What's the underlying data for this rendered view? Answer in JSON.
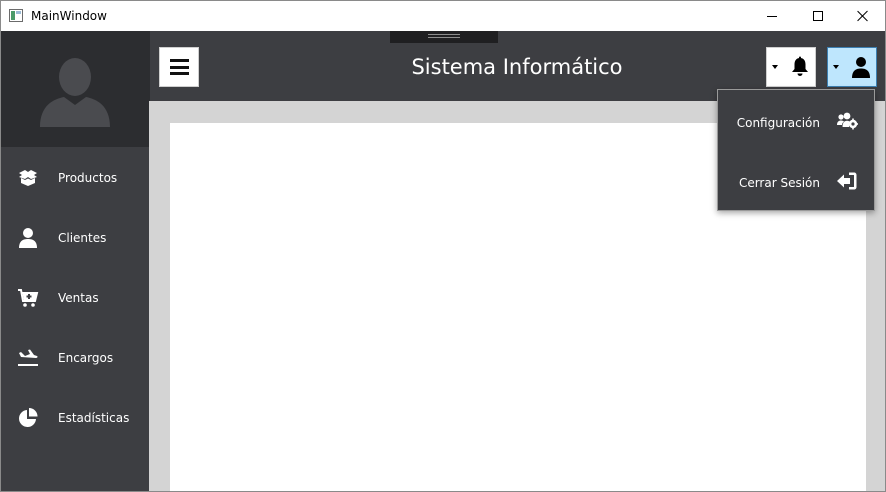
{
  "window": {
    "title": "MainWindow"
  },
  "header": {
    "title": "Sistema Informático",
    "menu_icon": "hamburger-icon",
    "notification_icon": "bell-icon",
    "user_icon": "user-icon"
  },
  "sidebar": {
    "avatar_icon": "user-silhouette-icon",
    "items": [
      {
        "label": "Productos",
        "icon": "boxes-icon"
      },
      {
        "label": "Clientes",
        "icon": "user-icon"
      },
      {
        "label": "Ventas",
        "icon": "cart-plus-icon"
      },
      {
        "label": "Encargos",
        "icon": "plane-arrival-icon"
      },
      {
        "label": "Estadísticas",
        "icon": "chart-pie-icon"
      }
    ]
  },
  "user_menu": {
    "items": [
      {
        "label": "Configuración",
        "icon": "users-cog-icon"
      },
      {
        "label": "Cerrar Sesión",
        "icon": "sign-out-icon"
      }
    ]
  },
  "colors": {
    "sidebar_bg": "#3d3e42",
    "profile_bg": "#2c2d30",
    "content_bg": "#d4d4d4",
    "card_bg": "#ffffff",
    "user_button_active": "#bee6fd"
  }
}
